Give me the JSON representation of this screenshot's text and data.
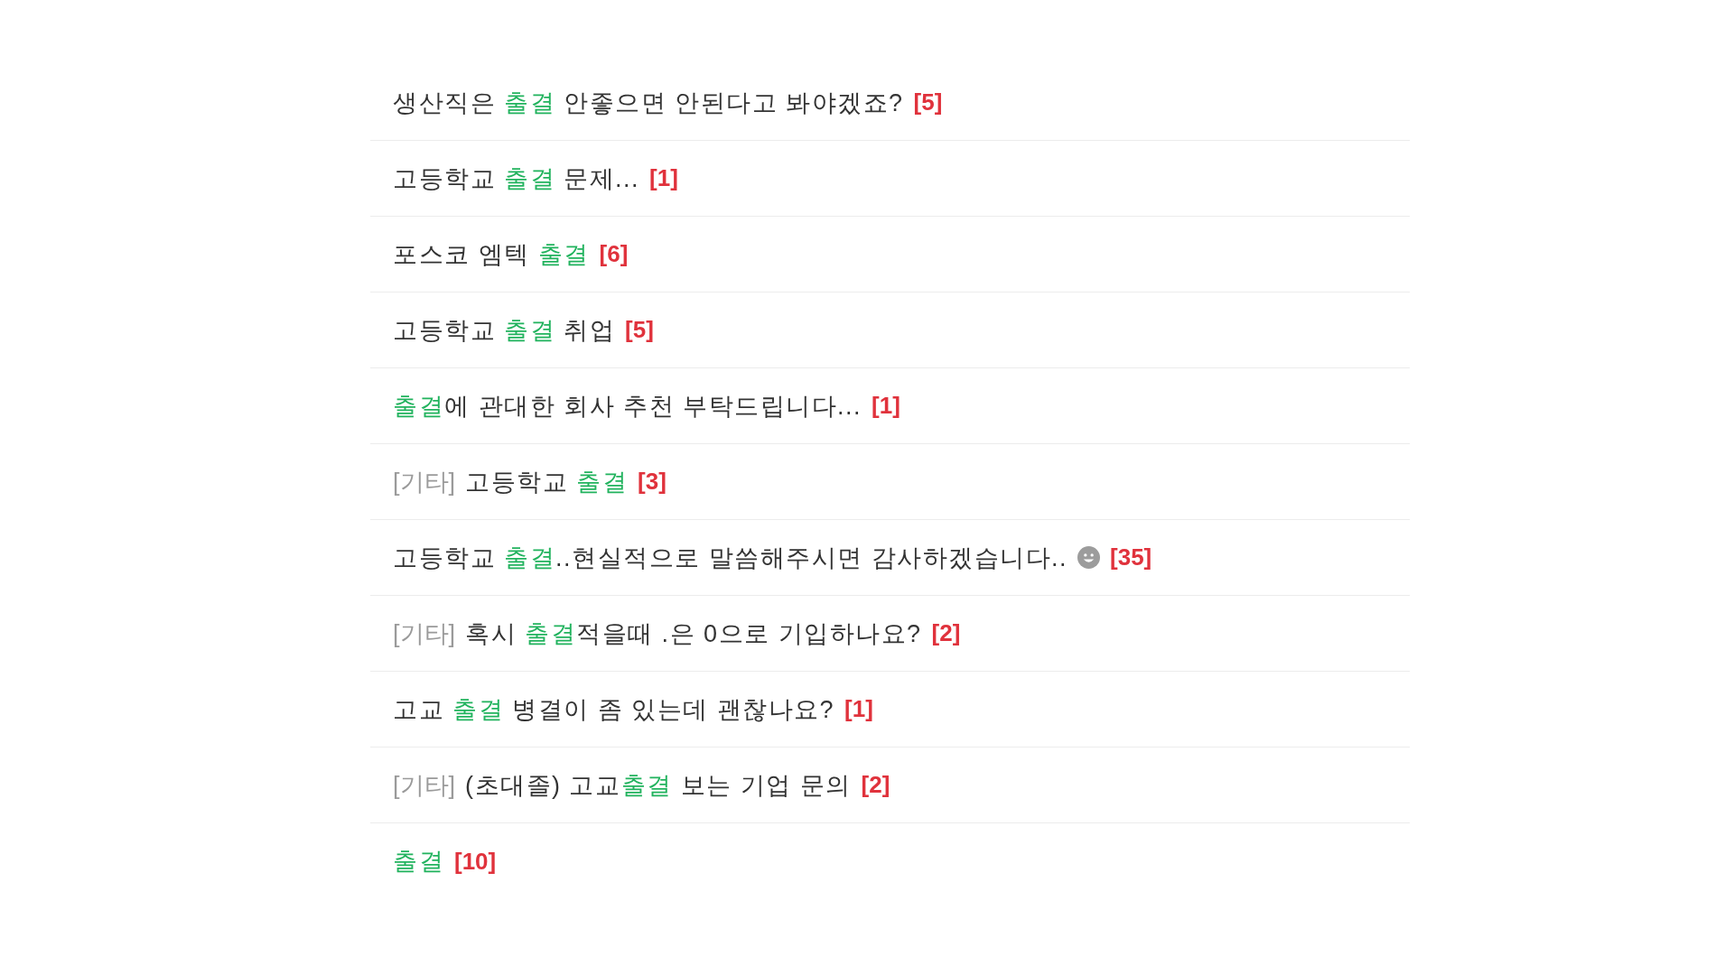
{
  "posts": [
    {
      "title": [
        {
          "text": "생산직은 ",
          "highlight": false
        },
        {
          "text": "출결",
          "highlight": true
        },
        {
          "text": " 안좋으면 안된다고 봐야겠죠?",
          "highlight": false
        }
      ],
      "emoticon": false,
      "comments": "[5]"
    },
    {
      "title": [
        {
          "text": "고등학교 ",
          "highlight": false
        },
        {
          "text": "출결",
          "highlight": true
        },
        {
          "text": " 문제...",
          "highlight": false
        }
      ],
      "emoticon": false,
      "comments": "[1]"
    },
    {
      "title": [
        {
          "text": "포스코 엠텍 ",
          "highlight": false
        },
        {
          "text": "출결",
          "highlight": true
        }
      ],
      "emoticon": false,
      "comments": "[6]"
    },
    {
      "title": [
        {
          "text": "고등학교 ",
          "highlight": false
        },
        {
          "text": "출결",
          "highlight": true
        },
        {
          "text": " 취업",
          "highlight": false
        }
      ],
      "emoticon": false,
      "comments": "[5]"
    },
    {
      "title": [
        {
          "text": "출결",
          "highlight": true
        },
        {
          "text": "에 관대한 회사 추천 부탁드립니다...",
          "highlight": false
        }
      ],
      "emoticon": false,
      "comments": "[1]"
    },
    {
      "category": "[기타]",
      "title": [
        {
          "text": "고등학교 ",
          "highlight": false
        },
        {
          "text": "출결",
          "highlight": true
        }
      ],
      "emoticon": false,
      "comments": "[3]"
    },
    {
      "title": [
        {
          "text": "고등학교 ",
          "highlight": false
        },
        {
          "text": "출결",
          "highlight": true
        },
        {
          "text": "..현실적으로 말씀해주시면 감사하겠습니다..",
          "highlight": false
        }
      ],
      "emoticon": true,
      "comments": "[35]"
    },
    {
      "category": "[기타]",
      "title": [
        {
          "text": "혹시 ",
          "highlight": false
        },
        {
          "text": "출결",
          "highlight": true
        },
        {
          "text": "적을때 .은 0으로 기입하나요?",
          "highlight": false
        }
      ],
      "emoticon": false,
      "comments": "[2]"
    },
    {
      "title": [
        {
          "text": "고교 ",
          "highlight": false
        },
        {
          "text": "출결",
          "highlight": true
        },
        {
          "text": " 병결이 좀 있는데 괜찮나요?",
          "highlight": false
        }
      ],
      "emoticon": false,
      "comments": "[1]"
    },
    {
      "category": "[기타]",
      "title": [
        {
          "text": "(초대졸) 고교",
          "highlight": false
        },
        {
          "text": "출결",
          "highlight": true
        },
        {
          "text": " 보는 기업 문의",
          "highlight": false
        }
      ],
      "emoticon": false,
      "comments": "[2]"
    },
    {
      "title": [
        {
          "text": "출결",
          "highlight": true
        }
      ],
      "emoticon": false,
      "comments": "[10]"
    }
  ]
}
